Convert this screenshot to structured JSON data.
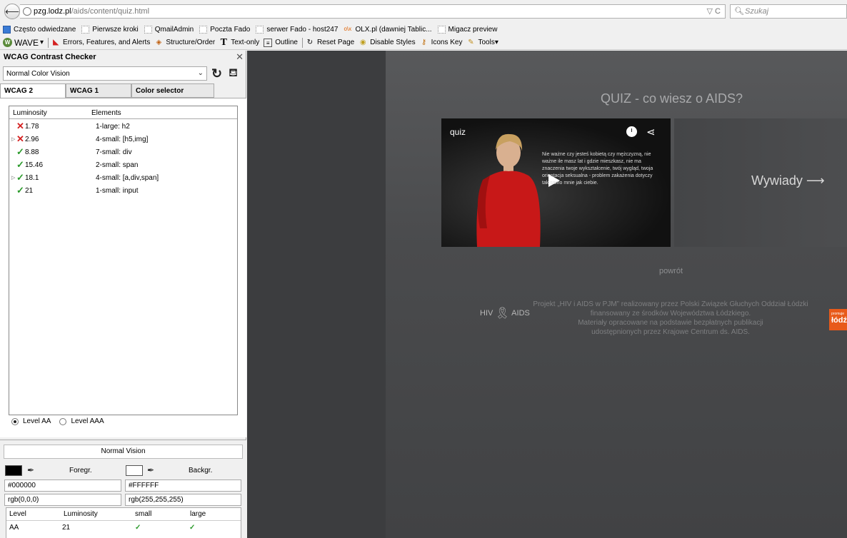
{
  "browser": {
    "url_host": "pzg.lodz.pl",
    "url_path": "/aids/content/quiz.html",
    "url_tools": "▽ C",
    "search_placeholder": "Szukaj"
  },
  "bookmarks": [
    {
      "label": "Często odwiedzane",
      "icon": "bookmark-icon"
    },
    {
      "label": "Pierwsze kroki",
      "icon": "page-icon"
    },
    {
      "label": "QmailAdmin",
      "icon": "page-icon"
    },
    {
      "label": "Poczta Fado",
      "icon": "page-icon"
    },
    {
      "label": "serwer Fado - host247",
      "icon": "page-icon"
    },
    {
      "label": "OLX.pl (dawniej Tablic...",
      "icon": "olx-icon"
    },
    {
      "label": "Migacz preview",
      "icon": "page-icon"
    }
  ],
  "wave_toolbar": {
    "wave_label": "WAVE",
    "items": [
      {
        "label": "Errors, Features, and Alerts",
        "icon": "errors-icon"
      },
      {
        "label": "Structure/Order",
        "icon": "structure-icon"
      },
      {
        "label": "Text-only",
        "icon": "text-icon"
      },
      {
        "label": "Outline",
        "icon": "outline-icon"
      },
      {
        "label": "Reset Page",
        "icon": "reset-icon"
      },
      {
        "label": "Disable Styles",
        "icon": "disable-styles-icon"
      },
      {
        "label": "Icons Key",
        "icon": "key-icon"
      },
      {
        "label": "Tools",
        "icon": "tools-icon"
      }
    ]
  },
  "sidebar": {
    "title": "WCAG Contrast Checker",
    "vision_mode": "Normal Color Vision",
    "tabs": [
      "WCAG 2",
      "WCAG 1",
      "Color selector"
    ],
    "results_headers": {
      "luminosity": "Luminosity",
      "elements": "Elements"
    },
    "results": [
      {
        "status": "fail",
        "expandable": false,
        "luminosity": "1.78",
        "elements": "1-large: h2"
      },
      {
        "status": "fail",
        "expandable": true,
        "luminosity": "2.96",
        "elements": "4-small: [h5,img]"
      },
      {
        "status": "pass",
        "expandable": false,
        "luminosity": "8.88",
        "elements": "7-small: div"
      },
      {
        "status": "pass",
        "expandable": false,
        "luminosity": "15.46",
        "elements": "2-small: span"
      },
      {
        "status": "pass",
        "expandable": true,
        "luminosity": "18.1",
        "elements": "4-small: [a,div,span]"
      },
      {
        "status": "pass",
        "expandable": false,
        "luminosity": "21",
        "elements": "1-small: input"
      }
    ],
    "levels": {
      "aa": "Level AA",
      "aaa": "Level AAA",
      "selected": "aa"
    },
    "normal_vision": "Normal Vision",
    "foreground": {
      "label": "Foregr.",
      "hex": "#000000",
      "rgb": "rgb(0,0,0)",
      "swatch": "#000000"
    },
    "background": {
      "label": "Backgr.",
      "hex": "#FFFFFF",
      "rgb": "rgb(255,255,255)",
      "swatch": "#FFFFFF"
    },
    "level_table": {
      "headers": [
        "Level",
        "Luminosity",
        "small",
        "large"
      ],
      "rows": [
        {
          "level": "AA",
          "luminosity": "21",
          "small": "✓",
          "large": "✓"
        }
      ]
    }
  },
  "page": {
    "quiz_title": "QUIZ - co wiesz o AIDS?",
    "video_title": "quiz",
    "video_subtitle": "Nie ważne czy jesteś kobietą czy mężczyzną, nie ważne ile masz lat i gdzie mieszkasz, nie ma znaczenia twoje wykształcenie, twój wygląd, twoja orientacja seksualna - problem zakażenia dotyczy tak samo mnie jak ciebie.",
    "interviews_label": "Wywiady ⟶",
    "back_link": "powrót",
    "hiv_logo_left": "HIV",
    "hiv_logo_right": "AIDS",
    "project_lines": [
      "Projekt „HIV i AIDS w PJM” realizowany przez Polski Związek Głuchych Oddział Łódzki",
      "finansowany ze środków Województwa Łódzkiego.",
      "Materiały opracowane na podstawie bezpłatnych publikacji",
      "udostępnionych przez Krajowe Centrum ds. AIDS."
    ],
    "badge_small": "promuje",
    "badge_text": "łódź"
  }
}
